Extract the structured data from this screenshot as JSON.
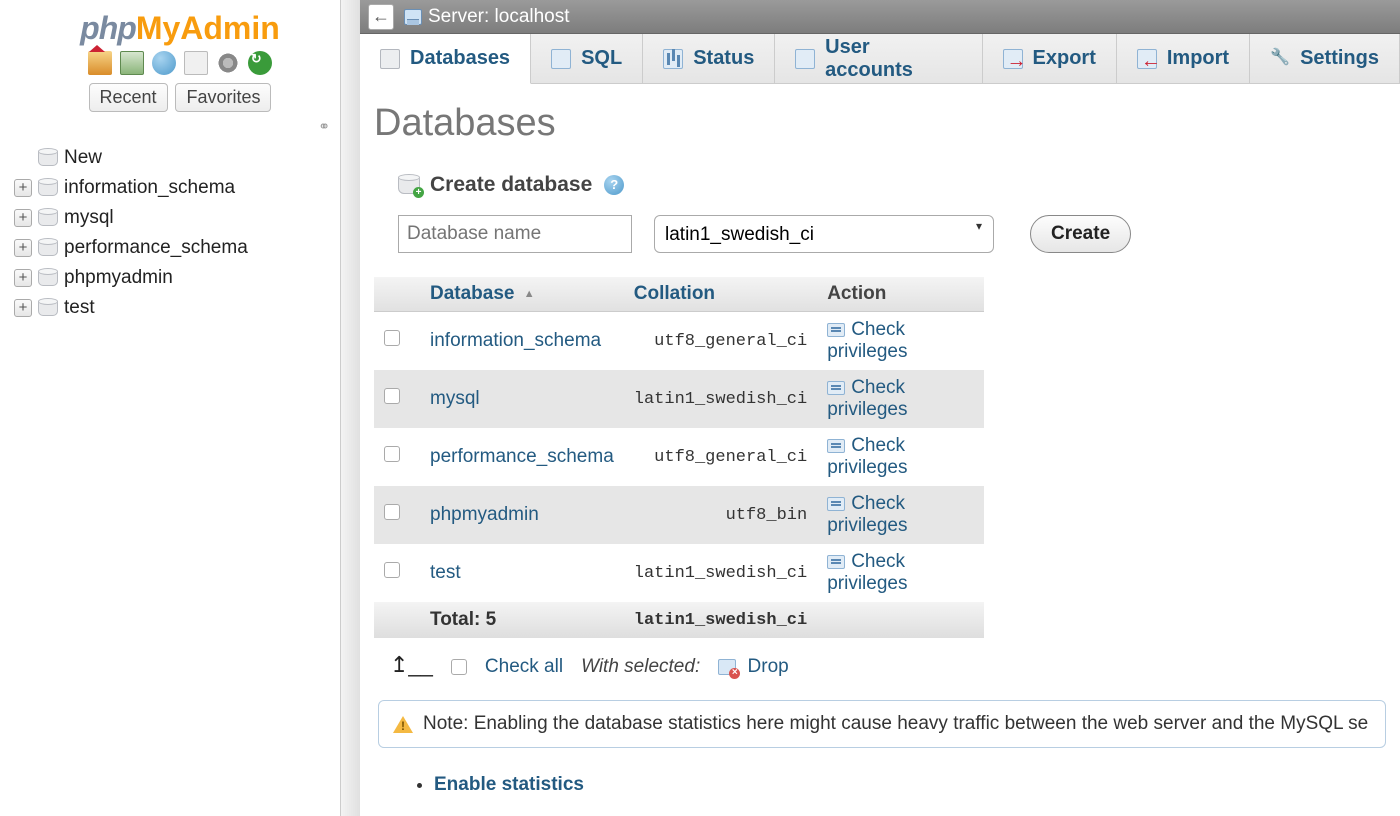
{
  "logo": {
    "part1": "php",
    "part2": "MyAdmin"
  },
  "sidebar_tabs": {
    "recent": "Recent",
    "favorites": "Favorites"
  },
  "tree": {
    "new_label": "New",
    "items": [
      "information_schema",
      "mysql",
      "performance_schema",
      "phpmyadmin",
      "test"
    ]
  },
  "breadcrumb": {
    "server_label": "Server:",
    "server_name": "localhost"
  },
  "nav": {
    "databases": "Databases",
    "sql": "SQL",
    "status": "Status",
    "users": "User accounts",
    "export": "Export",
    "import": "Import",
    "settings": "Settings"
  },
  "page_title": "Databases",
  "create": {
    "heading": "Create database",
    "placeholder": "Database name",
    "collation": "latin1_swedish_ci",
    "button": "Create"
  },
  "table": {
    "headers": {
      "database": "Database",
      "collation": "Collation",
      "action": "Action"
    },
    "rows": [
      {
        "name": "information_schema",
        "collation": "utf8_general_ci",
        "action": "Check privileges"
      },
      {
        "name": "mysql",
        "collation": "latin1_swedish_ci",
        "action": "Check privileges"
      },
      {
        "name": "performance_schema",
        "collation": "utf8_general_ci",
        "action": "Check privileges"
      },
      {
        "name": "phpmyadmin",
        "collation": "utf8_bin",
        "action": "Check privileges"
      },
      {
        "name": "test",
        "collation": "latin1_swedish_ci",
        "action": "Check privileges"
      }
    ],
    "total_label": "Total: 5",
    "total_collation": "latin1_swedish_ci"
  },
  "with_selected": {
    "check_all": "Check all",
    "label": "With selected:",
    "drop": "Drop"
  },
  "note": "Note: Enabling the database statistics here might cause heavy traffic between the web server and the MySQL se",
  "enable_link": "Enable statistics"
}
